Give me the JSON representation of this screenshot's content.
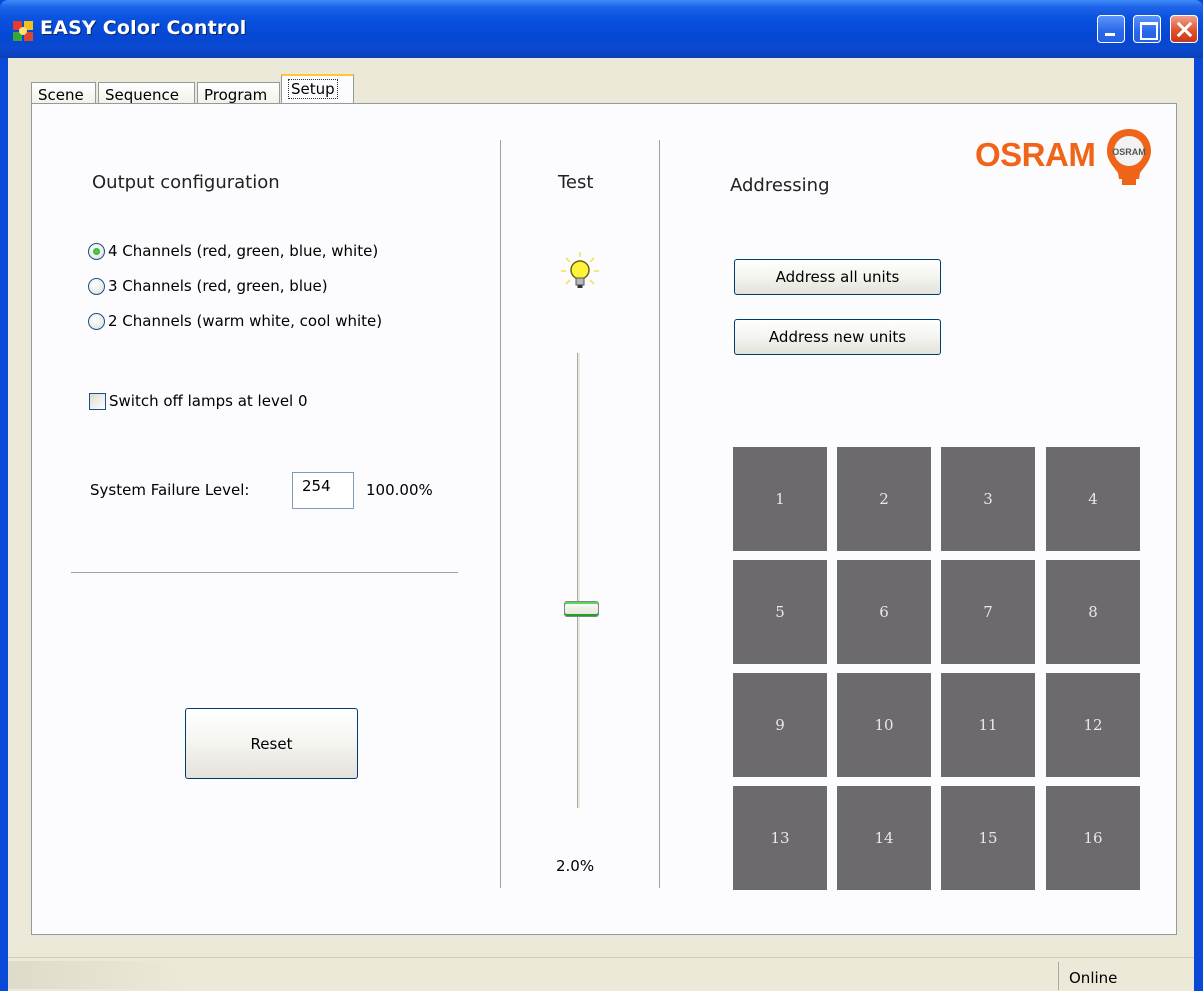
{
  "window": {
    "title": "EASY Color Control"
  },
  "tabs": [
    {
      "label": "Scene"
    },
    {
      "label": "Sequence"
    },
    {
      "label": "Program"
    },
    {
      "label": "Setup",
      "active": true
    }
  ],
  "output_configuration": {
    "heading": "Output configuration",
    "options": [
      {
        "label": "4 Channels (red, green, blue, white)",
        "checked": true
      },
      {
        "label": "3 Channels (red, green, blue)",
        "checked": false
      },
      {
        "label": "2 Channels (warm white, cool white)",
        "checked": false
      }
    ],
    "switch_off_label": "Switch off lamps at level 0",
    "switch_off_checked": false,
    "system_failure_label": "System Failure Level:",
    "system_failure_value": "254",
    "system_failure_percent": "100.00%",
    "reset_label": "Reset"
  },
  "test": {
    "heading": "Test",
    "level_text": "2.0%",
    "level_fraction": 0.02,
    "bulb_icon": "light-bulb-icon"
  },
  "addressing": {
    "heading": "Addressing",
    "address_all_label": "Address all units",
    "address_new_label": "Address new units",
    "units": [
      "1",
      "2",
      "3",
      "4",
      "5",
      "6",
      "7",
      "8",
      "9",
      "10",
      "11",
      "12",
      "13",
      "14",
      "15",
      "16"
    ],
    "unit_color": "#6c6a6c"
  },
  "brand": {
    "logo_text": "OSRAM",
    "badge_text": "OSRAM",
    "color": "#f06419"
  },
  "statusbar": {
    "status": "Online"
  }
}
